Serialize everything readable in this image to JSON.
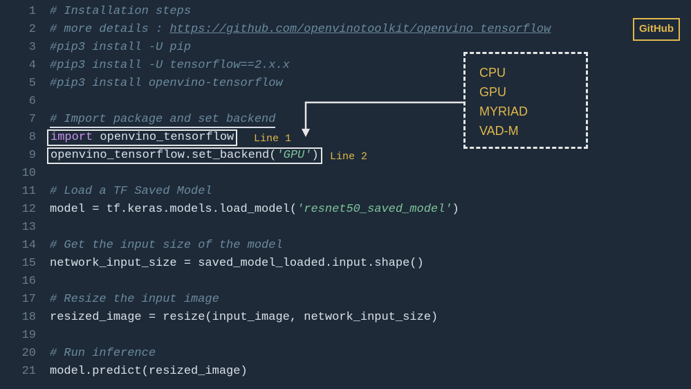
{
  "gutter": [
    "1",
    "2",
    "3",
    "4",
    "5",
    "6",
    "7",
    "8",
    "9",
    "10",
    "11",
    "12",
    "13",
    "14",
    "15",
    "16",
    "17",
    "18",
    "19",
    "20",
    "21"
  ],
  "github_label": "GitHub",
  "backends": {
    "b0": "CPU",
    "b1": "GPU",
    "b2": "MYRIAD",
    "b3": "VAD-M"
  },
  "code": {
    "l1": "# Installation steps",
    "l2a": "# more details : ",
    "l2b": "https://github.com/openvinotoolkit/openvino_tensorflow",
    "l3": "#pip3 install -U pip",
    "l4": "#pip3 install -U tensorflow==2.x.x",
    "l5": "#pip3 install openvino-tensorflow",
    "l6": "",
    "l7": "# Import package and set backend",
    "l8_kw": "import",
    "l8_rest": " openvino_tensorflow",
    "l8_label": "Line 1",
    "l9a": "openvino_tensorflow.set_backend(",
    "l9b": "'GPU'",
    "l9c": ")",
    "l9_label": "Line 2",
    "l10": "",
    "l11": "# Load a TF Saved Model",
    "l12a": "model = tf.keras.models.load_model(",
    "l12b": "'resnet50_saved_model'",
    "l12c": ")",
    "l13": "",
    "l14": "# Get the input size of the model",
    "l15": "network_input_size = saved_model_loaded.input.shape()",
    "l16": "",
    "l17": "# Resize the input image",
    "l18": "resized_image = resize(input_image, network_input_size)",
    "l19": "",
    "l20": "# Run inference",
    "l21": "model.predict(resized_image)"
  }
}
